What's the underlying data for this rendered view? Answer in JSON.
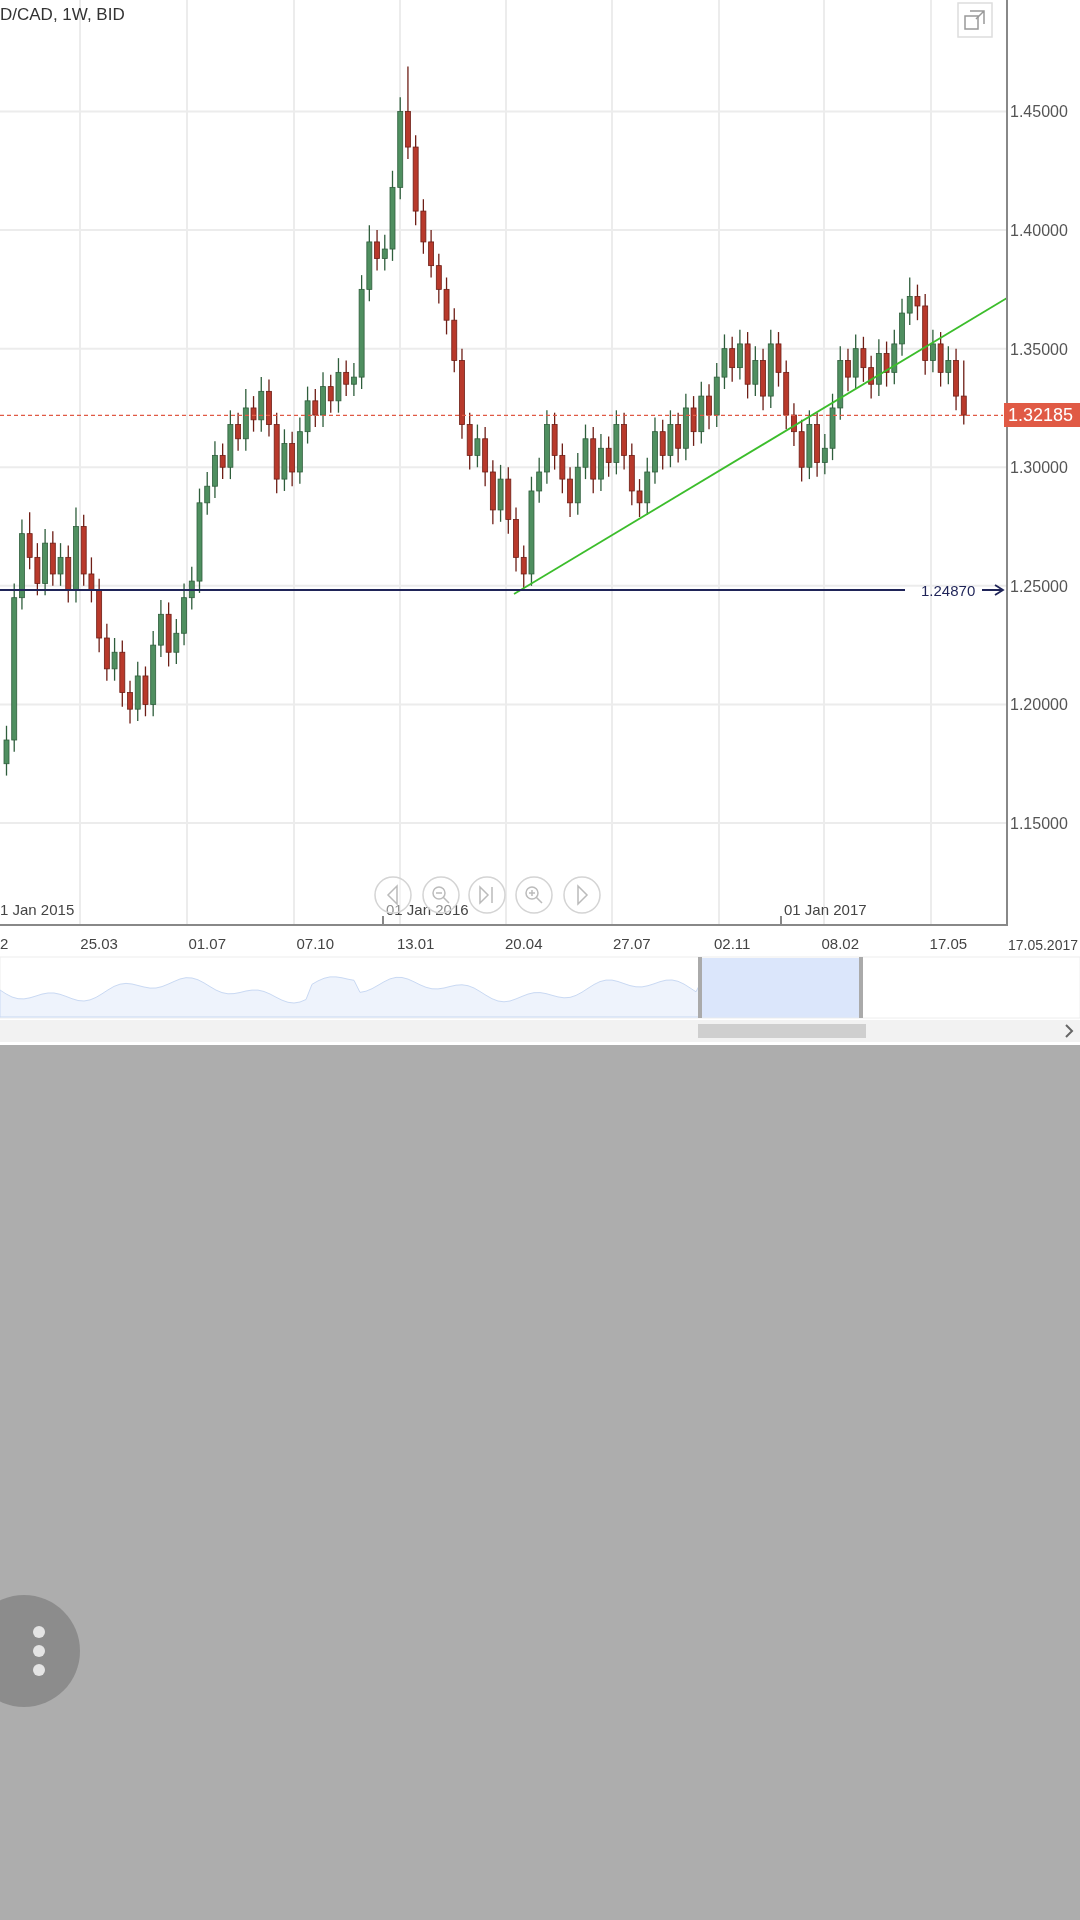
{
  "chart_header": {
    "title": "D/CAD, 1W, BID"
  },
  "price_chart": {
    "chart_data": {
      "type": "candlestick",
      "yticks": [
        {
          "value": 1.45,
          "label": "1.45000"
        },
        {
          "value": 1.4,
          "label": "1.40000"
        },
        {
          "value": 1.35,
          "label": "1.35000"
        },
        {
          "value": 1.3,
          "label": "1.30000"
        },
        {
          "value": 1.25,
          "label": "1.25000"
        },
        {
          "value": 1.2,
          "label": "1.20000"
        },
        {
          "value": 1.15,
          "label": "1.15000"
        }
      ],
      "ylim": [
        1.107,
        1.497
      ],
      "ohlc": [
        [
          1.175,
          1.191,
          1.17,
          1.185
        ],
        [
          1.185,
          1.251,
          1.18,
          1.245
        ],
        [
          1.245,
          1.278,
          1.24,
          1.272
        ],
        [
          1.272,
          1.281,
          1.257,
          1.262
        ],
        [
          1.262,
          1.268,
          1.246,
          1.251
        ],
        [
          1.251,
          1.274,
          1.246,
          1.268
        ],
        [
          1.268,
          1.273,
          1.25,
          1.255
        ],
        [
          1.255,
          1.268,
          1.25,
          1.262
        ],
        [
          1.262,
          1.267,
          1.243,
          1.248
        ],
        [
          1.248,
          1.283,
          1.243,
          1.275
        ],
        [
          1.275,
          1.28,
          1.25,
          1.255
        ],
        [
          1.255,
          1.262,
          1.243,
          1.248
        ],
        [
          1.248,
          1.253,
          1.222,
          1.228
        ],
        [
          1.228,
          1.234,
          1.21,
          1.215
        ],
        [
          1.215,
          1.228,
          1.21,
          1.222
        ],
        [
          1.222,
          1.227,
          1.199,
          1.205
        ],
        [
          1.205,
          1.21,
          1.192,
          1.198
        ],
        [
          1.198,
          1.218,
          1.193,
          1.212
        ],
        [
          1.212,
          1.216,
          1.195,
          1.2
        ],
        [
          1.2,
          1.231,
          1.195,
          1.225
        ],
        [
          1.225,
          1.244,
          1.22,
          1.238
        ],
        [
          1.238,
          1.243,
          1.216,
          1.222
        ],
        [
          1.222,
          1.236,
          1.217,
          1.23
        ],
        [
          1.23,
          1.251,
          1.225,
          1.245
        ],
        [
          1.245,
          1.258,
          1.24,
          1.252
        ],
        [
          1.252,
          1.291,
          1.247,
          1.285
        ],
        [
          1.285,
          1.298,
          1.28,
          1.292
        ],
        [
          1.292,
          1.311,
          1.287,
          1.305
        ],
        [
          1.305,
          1.31,
          1.295,
          1.3
        ],
        [
          1.3,
          1.324,
          1.295,
          1.318
        ],
        [
          1.318,
          1.323,
          1.307,
          1.312
        ],
        [
          1.312,
          1.333,
          1.307,
          1.325
        ],
        [
          1.325,
          1.33,
          1.315,
          1.32
        ],
        [
          1.32,
          1.338,
          1.315,
          1.332
        ],
        [
          1.332,
          1.337,
          1.313,
          1.318
        ],
        [
          1.318,
          1.323,
          1.289,
          1.295
        ],
        [
          1.295,
          1.316,
          1.29,
          1.31
        ],
        [
          1.31,
          1.315,
          1.292,
          1.298
        ],
        [
          1.298,
          1.321,
          1.293,
          1.315
        ],
        [
          1.315,
          1.334,
          1.31,
          1.328
        ],
        [
          1.328,
          1.333,
          1.317,
          1.322
        ],
        [
          1.322,
          1.34,
          1.317,
          1.334
        ],
        [
          1.334,
          1.339,
          1.323,
          1.328
        ],
        [
          1.328,
          1.346,
          1.323,
          1.34
        ],
        [
          1.34,
          1.345,
          1.33,
          1.335
        ],
        [
          1.335,
          1.344,
          1.33,
          1.338
        ],
        [
          1.338,
          1.381,
          1.333,
          1.375
        ],
        [
          1.375,
          1.402,
          1.37,
          1.395
        ],
        [
          1.395,
          1.4,
          1.383,
          1.388
        ],
        [
          1.388,
          1.398,
          1.383,
          1.392
        ],
        [
          1.392,
          1.425,
          1.387,
          1.418
        ],
        [
          1.418,
          1.456,
          1.413,
          1.45
        ],
        [
          1.45,
          1.469,
          1.43,
          1.435
        ],
        [
          1.435,
          1.44,
          1.402,
          1.408
        ],
        [
          1.408,
          1.413,
          1.39,
          1.395
        ],
        [
          1.395,
          1.4,
          1.38,
          1.385
        ],
        [
          1.385,
          1.39,
          1.369,
          1.375
        ],
        [
          1.375,
          1.38,
          1.356,
          1.362
        ],
        [
          1.362,
          1.367,
          1.34,
          1.345
        ],
        [
          1.345,
          1.35,
          1.312,
          1.318
        ],
        [
          1.318,
          1.323,
          1.299,
          1.305
        ],
        [
          1.305,
          1.318,
          1.3,
          1.312
        ],
        [
          1.312,
          1.317,
          1.292,
          1.298
        ],
        [
          1.298,
          1.303,
          1.276,
          1.282
        ],
        [
          1.282,
          1.301,
          1.277,
          1.295
        ],
        [
          1.295,
          1.3,
          1.272,
          1.278
        ],
        [
          1.278,
          1.283,
          1.256,
          1.262
        ],
        [
          1.262,
          1.267,
          1.249,
          1.255
        ],
        [
          1.255,
          1.296,
          1.25,
          1.29
        ],
        [
          1.29,
          1.304,
          1.285,
          1.298
        ],
        [
          1.298,
          1.324,
          1.293,
          1.318
        ],
        [
          1.318,
          1.323,
          1.299,
          1.305
        ],
        [
          1.305,
          1.31,
          1.289,
          1.295
        ],
        [
          1.295,
          1.3,
          1.279,
          1.285
        ],
        [
          1.285,
          1.306,
          1.28,
          1.3
        ],
        [
          1.3,
          1.318,
          1.295,
          1.312
        ],
        [
          1.312,
          1.317,
          1.289,
          1.295
        ],
        [
          1.295,
          1.314,
          1.29,
          1.308
        ],
        [
          1.308,
          1.313,
          1.296,
          1.302
        ],
        [
          1.302,
          1.324,
          1.297,
          1.318
        ],
        [
          1.318,
          1.323,
          1.299,
          1.305
        ],
        [
          1.305,
          1.31,
          1.284,
          1.29
        ],
        [
          1.29,
          1.295,
          1.279,
          1.285
        ],
        [
          1.285,
          1.304,
          1.28,
          1.298
        ],
        [
          1.298,
          1.321,
          1.293,
          1.315
        ],
        [
          1.315,
          1.32,
          1.299,
          1.305
        ],
        [
          1.305,
          1.324,
          1.3,
          1.318
        ],
        [
          1.318,
          1.323,
          1.302,
          1.308
        ],
        [
          1.308,
          1.331,
          1.303,
          1.325
        ],
        [
          1.325,
          1.33,
          1.309,
          1.315
        ],
        [
          1.315,
          1.336,
          1.31,
          1.33
        ],
        [
          1.33,
          1.335,
          1.316,
          1.322
        ],
        [
          1.322,
          1.344,
          1.317,
          1.338
        ],
        [
          1.338,
          1.356,
          1.333,
          1.35
        ],
        [
          1.35,
          1.355,
          1.336,
          1.342
        ],
        [
          1.342,
          1.358,
          1.337,
          1.352
        ],
        [
          1.352,
          1.357,
          1.329,
          1.335
        ],
        [
          1.335,
          1.351,
          1.33,
          1.345
        ],
        [
          1.345,
          1.35,
          1.324,
          1.33
        ],
        [
          1.33,
          1.358,
          1.325,
          1.352
        ],
        [
          1.352,
          1.357,
          1.334,
          1.34
        ],
        [
          1.34,
          1.345,
          1.316,
          1.322
        ],
        [
          1.322,
          1.327,
          1.309,
          1.315
        ],
        [
          1.315,
          1.32,
          1.294,
          1.3
        ],
        [
          1.3,
          1.324,
          1.295,
          1.318
        ],
        [
          1.318,
          1.323,
          1.296,
          1.302
        ],
        [
          1.302,
          1.314,
          1.297,
          1.308
        ],
        [
          1.308,
          1.331,
          1.303,
          1.325
        ],
        [
          1.325,
          1.351,
          1.32,
          1.345
        ],
        [
          1.345,
          1.35,
          1.332,
          1.338
        ],
        [
          1.338,
          1.356,
          1.333,
          1.35
        ],
        [
          1.35,
          1.355,
          1.336,
          1.342
        ],
        [
          1.342,
          1.347,
          1.329,
          1.335
        ],
        [
          1.335,
          1.354,
          1.33,
          1.348
        ],
        [
          1.348,
          1.353,
          1.334,
          1.34
        ],
        [
          1.34,
          1.358,
          1.335,
          1.352
        ],
        [
          1.352,
          1.371,
          1.347,
          1.365
        ],
        [
          1.365,
          1.38,
          1.36,
          1.372
        ],
        [
          1.372,
          1.377,
          1.362,
          1.368
        ],
        [
          1.368,
          1.373,
          1.339,
          1.345
        ],
        [
          1.345,
          1.358,
          1.34,
          1.352
        ],
        [
          1.352,
          1.357,
          1.334,
          1.34
        ],
        [
          1.34,
          1.351,
          1.335,
          1.345
        ],
        [
          1.345,
          1.35,
          1.324,
          1.33
        ],
        [
          1.33,
          1.345,
          1.318,
          1.322
        ]
      ]
    }
  },
  "current_price": {
    "label": "1.32185"
  },
  "horizontal_line": {
    "label": "1.24870"
  },
  "period_labels": [
    "1 Jan 2015",
    "01 Jan 2016",
    "01 Jan 2017"
  ],
  "date_axis": {
    "labels": [
      "2",
      "25.03",
      "01.07",
      "07.10",
      "13.01",
      "20.04",
      "27.07",
      "02.11",
      "08.02",
      "17.05"
    ],
    "end_label": "17.05.2017"
  }
}
